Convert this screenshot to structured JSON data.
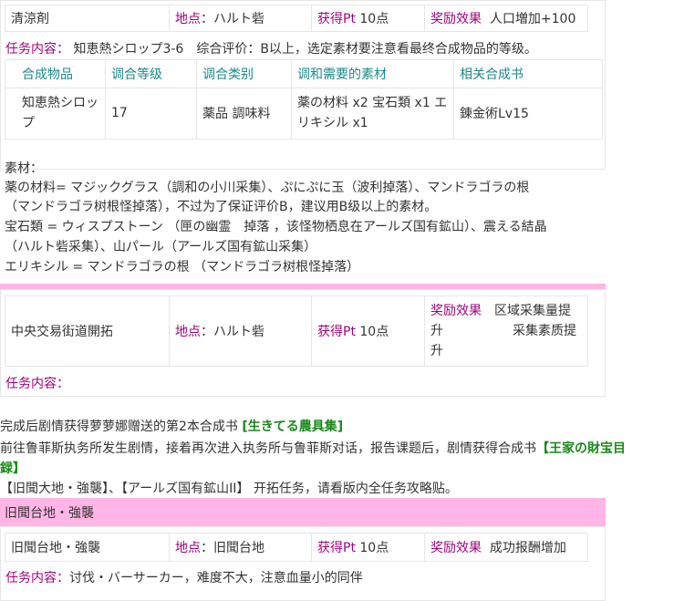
{
  "block1": {
    "name": "清涼剤",
    "location_label": "地点",
    "location_value": "ハルト砦",
    "pt_label": "获得Pt",
    "pt_value": "10点",
    "reward_label": "奖励效果",
    "reward_value": "人口増加+100",
    "content_label": "任务内容",
    "content_value": "知恵熱シロップ3-6　综合评价：B以上，选定素材要注意看最终合成物品的等级。"
  },
  "table": {
    "headers": [
      "合成物品",
      "调合等级",
      "调合类别",
      "调和需要的素材",
      "相关合成书"
    ],
    "row": {
      "item_line1": "知恵熱シロッ",
      "item_line2": "プ",
      "level": "17",
      "category": "薬品 調味料",
      "materials_line1": "薬の材料 x2 宝石類 x1 エ",
      "materials_line2": "リキシル x1",
      "book": "錬金術Lv15"
    }
  },
  "materials_text": {
    "lines": [
      "素材：",
      "薬の材料= マジックグラス（調和の小川采集）、ぷにぷに玉（波利掉落）、マンドラゴラの根",
      "（マンドラゴラ树根怪掉落），不过为了保证评价B，建议用B级以上的素材。",
      "宝石類 = ウィスプストーン （匣の幽霊　掉落 ，该怪物栖息在アールズ国有鉱山）、震える結晶",
      "（ハルト砦采集）、山パール（アールズ国有鉱山采集）",
      "エリキシル = マンドラゴラの根 （マンドラゴラ树根怪掉落）"
    ]
  },
  "block2": {
    "name": "中央交易街道開拓",
    "location_label": "地点",
    "location_value": "ハルト砦",
    "pt_label": "获得Pt",
    "pt_value": "10点",
    "reward_label": "奖励效果",
    "reward_value_1": "区域采集量提",
    "reward_value_2": "升",
    "reward_value_3": "采集素质提",
    "reward_value_4": "升",
    "content_label": "任务内容："
  },
  "story": {
    "line1_prefix": "完成后剧情获得萝萝娜赠送的第2本合成书",
    "line1_book": "[生きてる農具集]",
    "line2_prefix": "前往鲁菲斯执务所发生剧情，接着再次进入执务所与鲁菲斯对话，报告课题后，剧情获得合成书",
    "line2_book_a": "【王家の財宝目",
    "line2_book_b": "録】",
    "line3": "【旧聞大地・強襲】、【アールズ国有鉱山II】 开拓任务，请看版内全任务攻略贴。"
  },
  "block3": {
    "header": "旧聞台地・強襲",
    "name": "旧聞台地・強襲",
    "location_label": "地点",
    "location_value": "旧聞台地",
    "pt_label": "获得Pt",
    "pt_value": "10点",
    "reward_label": "奖励效果",
    "reward_value": "成功报酬增加",
    "content_label": "任务内容",
    "content_value": "讨伐・バーサーカー，难度不大，注意血量小的同伴"
  },
  "colors": {
    "label_magenta": "#a0037d",
    "header_teal": "#1a8a8a",
    "link_green": "#1a8a1a",
    "pink_bar": "#ffb6e6",
    "border": "#e6e6e6"
  }
}
